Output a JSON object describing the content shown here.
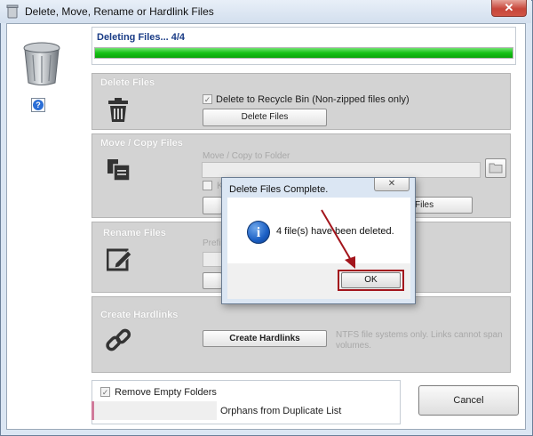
{
  "window": {
    "title": "Delete, Move, Rename or Hardlink Files",
    "close_glyph": "✕"
  },
  "progress": {
    "label": "Deleting Files... 4/4",
    "fraction": 1.0
  },
  "sections": {
    "delete": {
      "title": "Delete Files",
      "recycle_label": "Delete to Recycle Bin (Non-zipped files only)",
      "recycle_checked": true,
      "button": "Delete Files"
    },
    "move": {
      "title": "Move / Copy Files",
      "folder_label": "Move / Copy to Folder",
      "partial_check_label": "K",
      "partial_button": "Files"
    },
    "rename": {
      "title": "Rename Files",
      "prefix_label": "Prefi"
    },
    "hardlink": {
      "title": "Create Hardlinks",
      "button": "Create Hardlinks",
      "note": "NTFS file systems only.  Links cannot span volumes."
    }
  },
  "bottom": {
    "remove_empty_label": "Remove Empty Folders",
    "remove_empty_checked": true,
    "orphans_label": "Orphans from Duplicate List"
  },
  "cancel_label": "Cancel",
  "dialog": {
    "title": "Delete Files Complete.",
    "close_glyph": "✕",
    "message": "4 file(s) have been deleted.",
    "ok_label": "OK",
    "info_glyph": "i"
  },
  "help_glyph": "?",
  "colors": {
    "progress_green": "#16c116",
    "annotation_red": "#a3151c",
    "title_blue": "#1a3c86"
  }
}
